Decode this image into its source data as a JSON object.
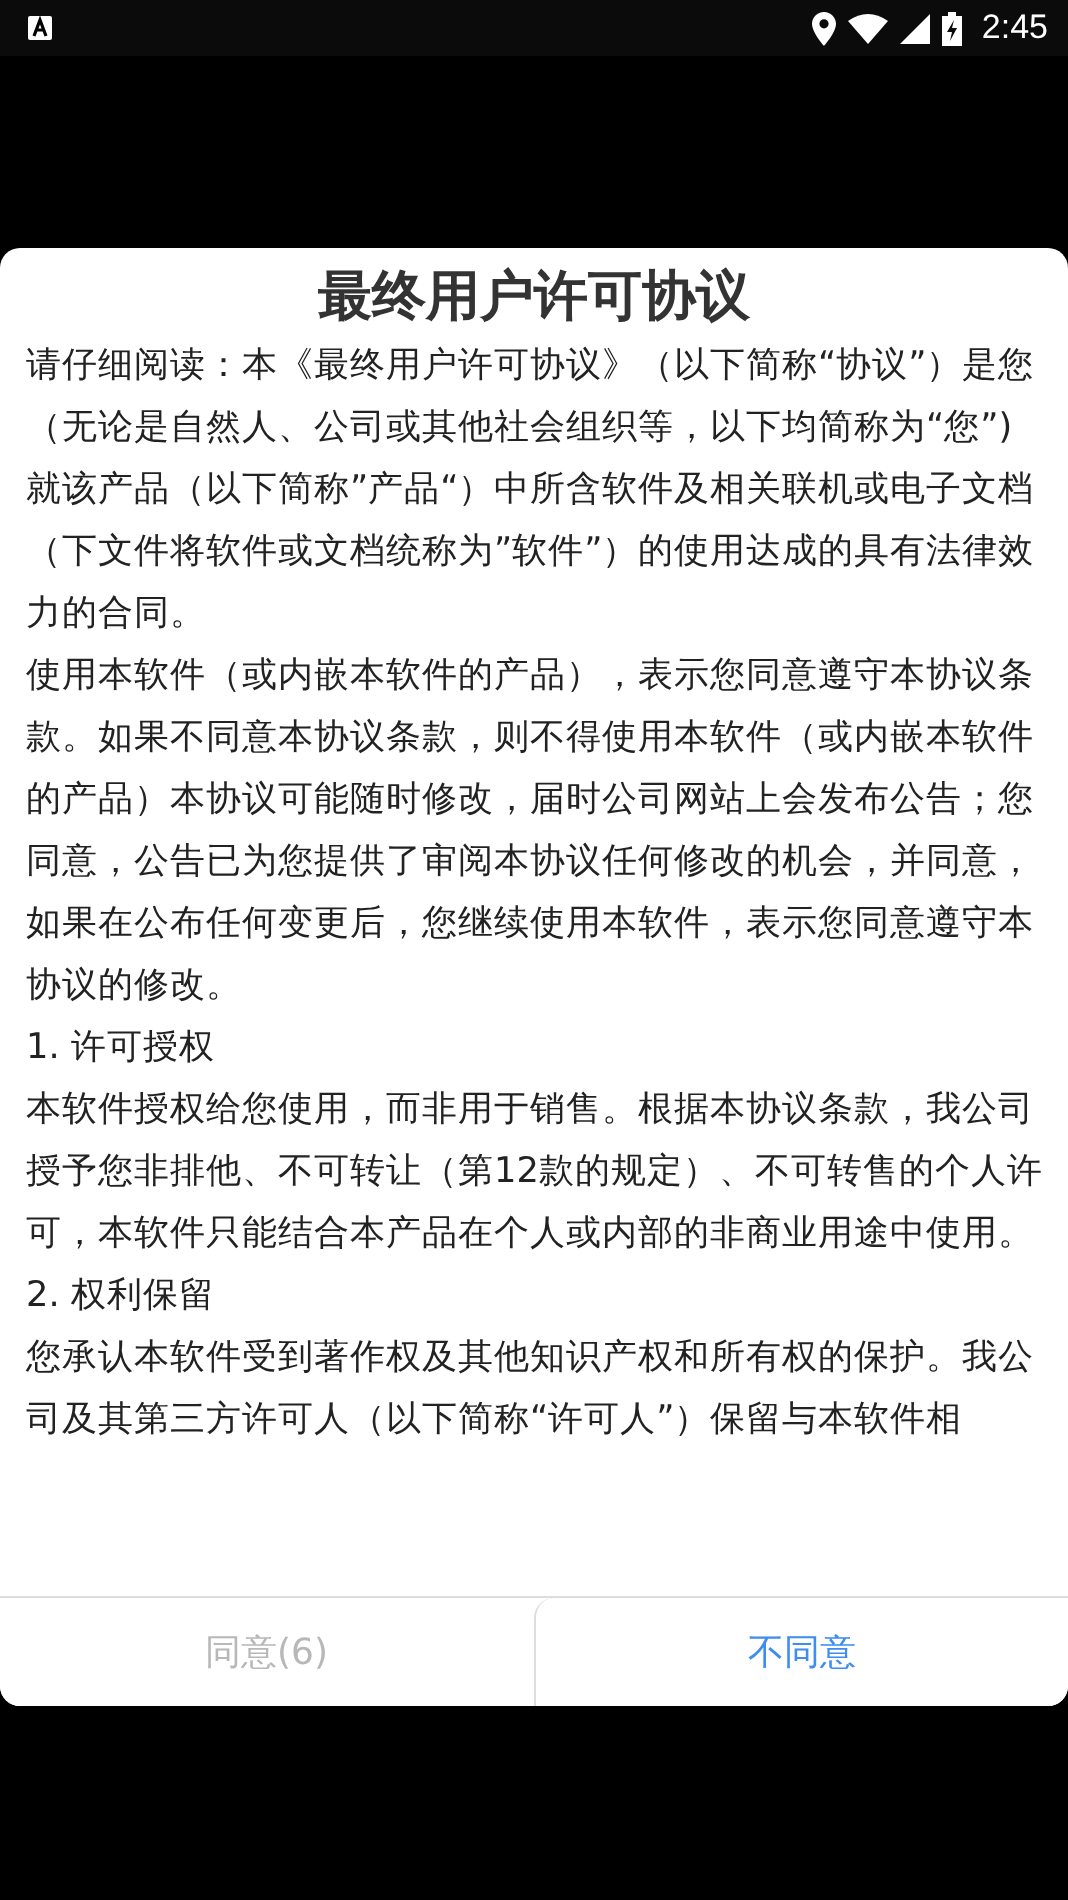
{
  "status_bar": {
    "time": "2:45"
  },
  "dialog": {
    "title": "最终用户许可协议",
    "paragraphs": [
      "请仔细阅读：本《最终用户许可协议》（以下简称“协议”）是您（无论是自然人、公司或其他社会组织等，以下均简称为“您”)就该产品（以下简称”产品“）中所含软件及相关联机或电子文档（下文件将软件或文档统称为”软件”）的使用达成的具有法律效力的合同。",
      "使用本软件（或内嵌本软件的产品），表示您同意遵守本协议条款。如果不同意本协议条款，则不得使用本软件（或内嵌本软件的产品）本协议可能随时修改，届时公司网站上会发布公告；您同意，公告已为您提供了审阅本协议任何修改的机会，并同意，如果在公布任何变更后，您继续使用本软件，表示您同意遵守本协议的修改。",
      "1. 许可授权",
      "本软件授权给您使用，而非用于销售。根据本协议条款，我公司授予您非排他、不可转让（第12款的规定）、不可转售的个人许可，本软件只能结合本产品在个人或内部的非商业用途中使用。",
      "2. 权利保留",
      "您承认本软件受到著作权及其他知识产权和所有权的保护。我公司及其第三方许可人（以下简称“许可人”）保留与本软件相"
    ],
    "buttons": [
      {
        "label": "同意(6)",
        "disabled": true
      },
      {
        "label": "不同意",
        "disabled": false
      }
    ]
  }
}
